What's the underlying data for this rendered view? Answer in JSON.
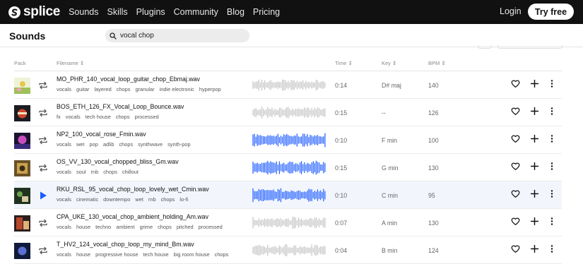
{
  "brand": {
    "name": "splice"
  },
  "nav": {
    "links": [
      "Sounds",
      "Skills",
      "Plugins",
      "Community",
      "Blog",
      "Pricing"
    ],
    "login": "Login",
    "try_free": "Try free"
  },
  "page": {
    "title": "Sounds"
  },
  "search": {
    "value": "vocal chop"
  },
  "columns": {
    "pack": "Pack",
    "filename": "Filename",
    "time": "Time",
    "key": "Key",
    "bpm": "BPM"
  },
  "colors": {
    "accent_wave": "#1f5cff",
    "grey_wave": "#c4c4c4",
    "play": "#1f5cff",
    "nav_bg": "#111111"
  },
  "rows": [
    {
      "filename": "MO_PHR_140_vocal_loop_guitar_chop_Ebmaj.wav",
      "tags": [
        "vocals",
        "guitar",
        "layered",
        "chops",
        "granular",
        "indie electronic",
        "hyperpop"
      ],
      "time": "0:14",
      "key": "D# maj",
      "bpm": "140",
      "wave_active": false,
      "selected": false,
      "art": "art-1"
    },
    {
      "filename": "BOS_ETH_126_FX_Vocal_Loop_Bounce.wav",
      "tags": [
        "fx",
        "vocals",
        "tech house",
        "chops",
        "processed"
      ],
      "time": "0:15",
      "key": "--",
      "bpm": "126",
      "wave_active": false,
      "selected": false,
      "art": "art-2"
    },
    {
      "filename": "NP2_100_vocal_rose_Fmin.wav",
      "tags": [
        "vocals",
        "wet",
        "pop",
        "adlib",
        "chops",
        "synthwave",
        "synth-pop"
      ],
      "time": "0:10",
      "key": "F min",
      "bpm": "100",
      "wave_active": true,
      "selected": false,
      "art": "art-3"
    },
    {
      "filename": "OS_VV_130_vocal_chopped_bliss_Gm.wav",
      "tags": [
        "vocals",
        "soul",
        "rnb",
        "chops",
        "chillout"
      ],
      "time": "0:15",
      "key": "G min",
      "bpm": "130",
      "wave_active": true,
      "selected": false,
      "art": "art-4"
    },
    {
      "filename": "RKU_RSL_95_vocal_chop_loop_lovely_wet_Cmin.wav",
      "tags": [
        "vocals",
        "cinematic",
        "downtempo",
        "wet",
        "rnb",
        "chops",
        "lo-fi"
      ],
      "time": "0:10",
      "key": "C min",
      "bpm": "95",
      "wave_active": true,
      "selected": true,
      "art": "art-5"
    },
    {
      "filename": "CPA_UKE_130_vocal_chop_ambient_holding_Am.wav",
      "tags": [
        "vocals",
        "house",
        "techno",
        "ambient",
        "grime",
        "chops",
        "pitched",
        "processed"
      ],
      "time": "0:07",
      "key": "A min",
      "bpm": "130",
      "wave_active": false,
      "selected": false,
      "art": "art-6"
    },
    {
      "filename": "T_HV2_124_vocal_chop_loop_my_mind_Bm.wav",
      "tags": [
        "vocals",
        "house",
        "progressive house",
        "tech house",
        "big room house",
        "chops"
      ],
      "time": "0:04",
      "key": "B min",
      "bpm": "124",
      "wave_active": false,
      "selected": false,
      "art": "art-7"
    }
  ]
}
